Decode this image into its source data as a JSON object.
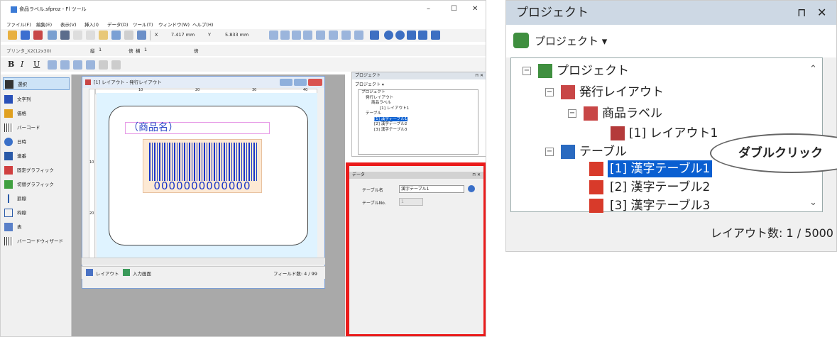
{
  "window": {
    "title": "食品ラベル.sfproz - Fl ツール",
    "min": "–",
    "max": "☐",
    "close": "✕"
  },
  "menu": [
    "ファイル(F)",
    "編集(E)",
    "表示(V)",
    "挿入(I)",
    "データ(D)",
    "ツール(T)",
    "ウィンドウ(W)",
    "ヘルプ(H)"
  ],
  "coords": {
    "x_label": "X",
    "x_value": "7.417 mm",
    "y_label": "Y",
    "y_value": "5.833 mm"
  },
  "printer": {
    "name": "プリンタ_X2(12x30)",
    "vert_label": "縦",
    "vert_value": "1",
    "mag_label": "倍",
    "horz_label": "横",
    "horz_value": "1",
    "mag2_label": "倍"
  },
  "format": {
    "bold": "B",
    "italic": "I",
    "underline": "U"
  },
  "tools": [
    "選択",
    "文字列",
    "価格",
    "バーコード",
    "日時",
    "連番",
    "固定グラフィック",
    "切替グラフィック",
    "罫線",
    "枠線",
    "表",
    "バーコードウィザード"
  ],
  "doc": {
    "title": "[1] レイアウト - 発行レイアウト",
    "ruler_top": [
      "10",
      "20",
      "30",
      "40"
    ],
    "ruler_left": [
      "10",
      "20"
    ],
    "product_name": "（商品名）",
    "barcode_number": "0000000000000",
    "tab_layout": "レイアウト",
    "tab_input": "入力画面",
    "field_count": "フィールド数: 4 / 99"
  },
  "small_project": {
    "header": "プロジェクト",
    "pin": "⊓ ✕",
    "toolbar": "プロジェクト ▾",
    "items": [
      "プロジェクト",
      "発行レイアウト",
      "商品ラベル",
      "[1] レイアウト1",
      "テーブル",
      "[1] 漢字テーブル1",
      "[2] 漢字テーブル2",
      "[3] 漢字テーブル3"
    ],
    "status": "レイアウト数: 1 / 5000"
  },
  "data_pane": {
    "header": "データ",
    "pin": "⊓ ✕",
    "table_name_label": "テーブル名",
    "table_name_value": "漢字テーブル1",
    "table_no_label": "テーブルNo.",
    "table_no_value": "1"
  },
  "zoom": {
    "header": "プロジェクト",
    "pin": "⊓",
    "close": "✕",
    "toolbar": "プロジェクト ▾",
    "root": "プロジェクト",
    "issue_layout": "発行レイアウト",
    "product_label": "商品ラベル",
    "layout1": "[1] レイアウト1",
    "table": "テーブル",
    "table1": "[1] 漢字テーブル1",
    "table2": "[2] 漢字テーブル2",
    "table3": "[3] 漢字テーブル3",
    "status": "レイアウト数: 1 / 5000"
  },
  "callout": "ダブルクリック",
  "colors": {
    "accent": "#0a5fd1",
    "highlight": "#ea1b1b"
  }
}
